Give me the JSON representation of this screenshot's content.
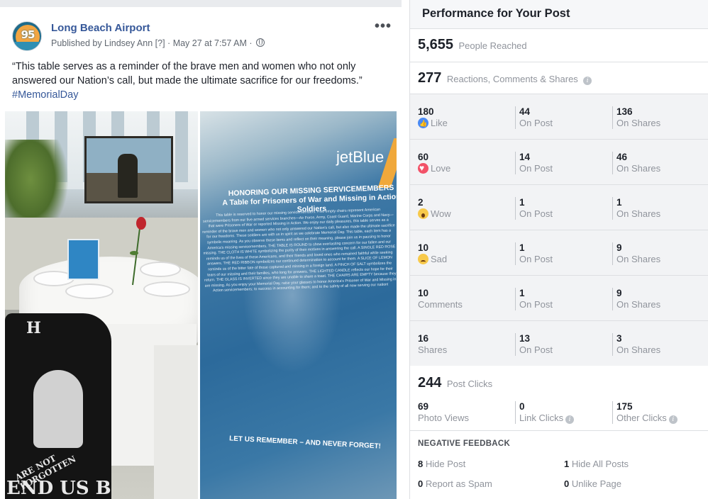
{
  "post": {
    "page_name": "Long Beach Airport",
    "avatar_text": "95",
    "published_by": "Published by Lindsey Ann",
    "published_marker": "[?]",
    "date": "May 27 at 7:57 AM",
    "more_label": "•••",
    "text": "“This table serves as a reminder of the brave men and women who not only answered our Nation’s call, but made the ultimate sacrifice for our freedoms.”",
    "hashtag": "#MemorialDay",
    "photo_right": {
      "logo": "jetBlue",
      "title_line1": "HONORING OUR MISSING SERVICEMEMBERS",
      "title_line2": "A Table for Prisoners of War and Missing in Action Soldiers",
      "body": "This table is reserved to honor our missing servicemembers. Five empty chairs represent American servicemembers from our five armed services branches—Air Force, Army, Coast Guard, Marine Corps and Navy—that were Prisoners of War or reported Missing in Action. We enjoy our daily pleasures, this table serves as a reminder of the brave men and women who not only answered our Nation's call, but also made the ultimate sacrifice for our freedoms. These soldiers are with us in spirit as we celebrate Memorial Day. This table, each item has a symbolic meaning. As you observe these items and reflect on their meaning, please join us in pausing to honor America's missing servicemembers. THE TABLE IS ROUND to show everlasting concern for our fallen and our missing. THE CLOTH IS WHITE symbolizing the purity of their motives in answering the call. A SINGLE RED ROSE reminds us of the lives of these Americans, and their friends and loved ones who remained faithful while seeking answers. THE RED RIBBON symbolizes our continued determination to account for them. A SLICE OF LEMON reminds us of the bitter fate of those captured and missing in a foreign land. A PINCH OF SALT symbolizes the tears of our missing and their families, who long for answers. THE LIGHTED CANDLE reflects our hope for their return. THE GLASS IS INVERTED since they are unable to share a toast. THE CHAIRS ARE EMPTY because they are missing. As you enjoy your Memorial Day, raise your glasses to honor America's Prisoner of War and Missing in Action servicemembers; to success in accounting for them; and to the safety of all now serving our nation!",
      "footer": "LET US REMEMBER – AND NEVER FORGET!"
    },
    "photo_left": {
      "flag_text_top": "H",
      "flag_text_arc": "ARE NOT FORGOTTEN",
      "flag_text_bottom": "END US B"
    }
  },
  "panel": {
    "title": "Performance for Your Post",
    "reached": {
      "value": "5,655",
      "label": "People Reached"
    },
    "engagement": {
      "value": "277",
      "label": "Reactions, Comments & Shares"
    },
    "rows": [
      {
        "icon": "like-icon",
        "total": "180",
        "name": "Like",
        "on_post": "44",
        "on_post_label": "On Post",
        "on_shares": "136",
        "on_shares_label": "On Shares"
      },
      {
        "icon": "love-icon",
        "total": "60",
        "name": "Love",
        "on_post": "14",
        "on_post_label": "On Post",
        "on_shares": "46",
        "on_shares_label": "On Shares"
      },
      {
        "icon": "wow-icon",
        "total": "2",
        "name": "Wow",
        "on_post": "1",
        "on_post_label": "On Post",
        "on_shares": "1",
        "on_shares_label": "On Shares"
      },
      {
        "icon": "sad-icon",
        "total": "10",
        "name": "Sad",
        "on_post": "1",
        "on_post_label": "On Post",
        "on_shares": "9",
        "on_shares_label": "On Shares"
      },
      {
        "icon": "",
        "total": "10",
        "name": "Comments",
        "on_post": "1",
        "on_post_label": "On Post",
        "on_shares": "9",
        "on_shares_label": "On Shares"
      },
      {
        "icon": "",
        "total": "16",
        "name": "Shares",
        "on_post": "13",
        "on_post_label": "On Post",
        "on_shares": "3",
        "on_shares_label": "On Shares"
      }
    ],
    "clicks": {
      "value": "244",
      "label": "Post Clicks",
      "photo_views": "69",
      "photo_views_label": "Photo Views",
      "link_clicks": "0",
      "link_clicks_label": "Link Clicks",
      "other_clicks": "175",
      "other_clicks_label": "Other Clicks"
    },
    "negative": {
      "title": "NEGATIVE FEEDBACK",
      "hide_post": "8",
      "hide_post_label": "Hide Post",
      "hide_all": "1",
      "hide_all_label": "Hide All Posts",
      "spam": "0",
      "spam_label": "Report as Spam",
      "unlike": "0",
      "unlike_label": "Unlike Page"
    },
    "info_icon_glyph": "i"
  },
  "colors": {
    "link": "#365899",
    "muted": "#90949c",
    "panel_bg": "#f6f7f9",
    "like": "#4a8af4",
    "love": "#f25268",
    "reaction_yellow": "#f7c94a"
  }
}
